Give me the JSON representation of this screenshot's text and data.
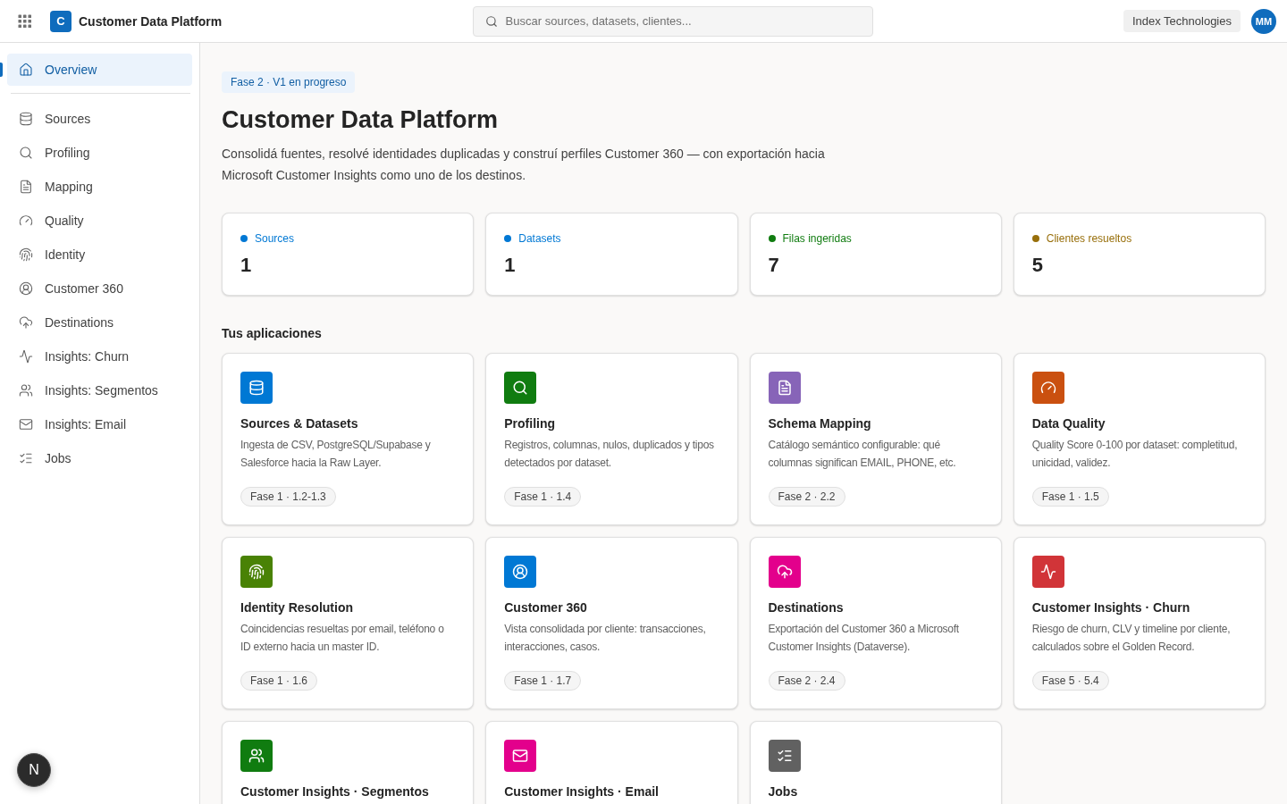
{
  "header": {
    "logo_letter": "C",
    "app_title": "Customer Data Platform",
    "search": {
      "placeholder": "Buscar sources, datasets, clientes..."
    },
    "organization": "Index Technologies",
    "avatar_initials": "MM"
  },
  "sidebar": {
    "groups": [
      {
        "items": [
          {
            "label": "Overview",
            "selected": true
          }
        ]
      },
      {
        "items": [
          {
            "label": "Sources",
            "selected": false
          },
          {
            "label": "Profiling",
            "selected": false
          },
          {
            "label": "Mapping",
            "selected": false
          },
          {
            "label": "Quality",
            "selected": false
          },
          {
            "label": "Identity",
            "selected": false
          },
          {
            "label": "Customer 360",
            "selected": false
          },
          {
            "label": "Destinations",
            "selected": false
          },
          {
            "label": "Insights: Churn",
            "selected": false
          },
          {
            "label": "Insights: Segmentos",
            "selected": false
          },
          {
            "label": "Insights: Email",
            "selected": false
          },
          {
            "label": "Jobs",
            "selected": false
          }
        ]
      }
    ]
  },
  "page": {
    "status_badge": "Fase 2 · V1 en progreso",
    "title": "Customer Data Platform",
    "description": "Consolidá fuentes, resolvé identidades duplicadas y construí perfiles Customer 360 — con exportación hacia Microsoft Customer Insights como uno de los destinos."
  },
  "stats": [
    {
      "label": "Sources",
      "value": "1",
      "color": "#0078d4"
    },
    {
      "label": "Datasets",
      "value": "1",
      "color": "#0078d4"
    },
    {
      "label": "Filas ingeridas",
      "value": "7",
      "color": "#107c10"
    },
    {
      "label": "Clientes resueltos",
      "value": "5",
      "color": "#986f0b"
    }
  ],
  "apps_section": {
    "title": "Tus aplicaciones",
    "apps": [
      {
        "title": "Sources & Datasets",
        "description": "Ingesta de CSV, PostgreSQL/Supabase y Salesforce hacia la Raw Layer.",
        "phase": "Fase 1 · 1.2-1.3",
        "color": "#0078d4"
      },
      {
        "title": "Profiling",
        "description": "Registros, columnas, nulos, duplicados y tipos detectados por dataset.",
        "phase": "Fase 1 · 1.4",
        "color": "#107c10"
      },
      {
        "title": "Schema Mapping",
        "description": "Catálogo semántico configurable: qué columnas significan EMAIL, PHONE, etc.",
        "phase": "Fase 2 · 2.2",
        "color": "#8764b8"
      },
      {
        "title": "Data Quality",
        "description": "Quality Score 0-100 por dataset: completitud, unicidad, validez.",
        "phase": "Fase 1 · 1.5",
        "color": "#ca5010"
      },
      {
        "title": "Identity Resolution",
        "description": "Coincidencias resueltas por email, teléfono o ID externo hacia un master ID.",
        "phase": "Fase 1 · 1.6",
        "color": "#498205"
      },
      {
        "title": "Customer 360",
        "description": "Vista consolidada por cliente: transacciones, interacciones, casos.",
        "phase": "Fase 1 · 1.7",
        "color": "#0078d4"
      },
      {
        "title": "Destinations",
        "description": "Exportación del Customer 360 a Microsoft Customer Insights (Dataverse).",
        "phase": "Fase 2 · 2.4",
        "color": "#e3008c"
      },
      {
        "title": "Customer Insights · Churn",
        "description": "Riesgo de churn, CLV y timeline por cliente, calculados sobre el Golden Record.",
        "phase": "Fase 5 · 5.4",
        "color": "#d13438"
      },
      {
        "title": "Customer Insights · Segmentos",
        "color": "#107c10"
      },
      {
        "title": "Customer Insights · Email",
        "color": "#e3008c"
      },
      {
        "title": "Jobs",
        "color": "#616161"
      }
    ]
  },
  "dev_indicator": {
    "label": "N"
  }
}
